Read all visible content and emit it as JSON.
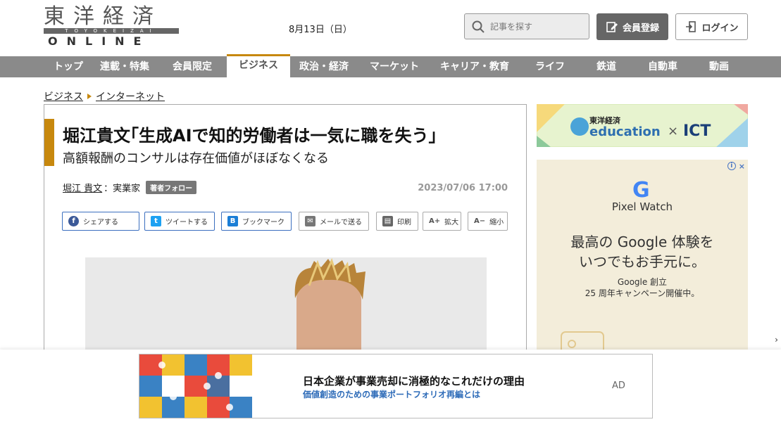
{
  "header": {
    "logo_kanji": "東洋経済",
    "logo_roman": "TOYOKEIZAI",
    "logo_online": "ONLINE",
    "date": "8月13日（日）",
    "search_placeholder": "記事を探す",
    "register_label": "会員登録",
    "login_label": "ログイン"
  },
  "nav": {
    "items": [
      {
        "label": "トップ"
      },
      {
        "label": "連載・特集"
      },
      {
        "label": "会員限定"
      },
      {
        "label": "ビジネス",
        "active": true
      },
      {
        "label": "政治・経済"
      },
      {
        "label": "マーケット"
      },
      {
        "label": "キャリア・教育"
      },
      {
        "label": "ライフ"
      },
      {
        "label": "鉄道"
      },
      {
        "label": "自動車"
      },
      {
        "label": "動画"
      }
    ]
  },
  "breadcrumb": [
    "ビジネス",
    "インターネット"
  ],
  "article": {
    "title": "堀江貴文｢生成AIで知的労働者は一気に職を失う｣",
    "subtitle": "高額報酬のコンサルは存在価値がほぼなくなる",
    "author_name": "堀江 貴文",
    "author_role": "：実業家",
    "follow_label": "著者フォロー",
    "pubdate": "2023/07/06 17:00",
    "share_buttons": [
      "シェアする",
      "ツイートする",
      "ブックマーク",
      "メールで送る",
      "印刷",
      "拡大",
      "縮小"
    ]
  },
  "sidebar": {
    "banner_brand": "東洋経済",
    "banner_word": "education",
    "banner_cross": "×",
    "banner_ict": "ICT",
    "ad_logo": "G",
    "ad_product": "Pixel Watch",
    "ad_headline_1": "最高の Google 体験を",
    "ad_headline_2": "いつでもお手元に。",
    "ad_small_1": "Google 創立",
    "ad_small_2": "25 周年キャンペーン開催中。",
    "ad_info": "i",
    "ad_close": "×"
  },
  "bottom_ad": {
    "title": "日本企業が事業売却に消極的なこれだけの理由",
    "subtitle": "価値創造のための事業ポートフォリオ再編とは",
    "label": "AD"
  },
  "side_arrow": "›",
  "colors": {
    "accent": "#c7880e",
    "nav_bg": "#8a8a8a",
    "link_blue": "#2d6bb8"
  }
}
